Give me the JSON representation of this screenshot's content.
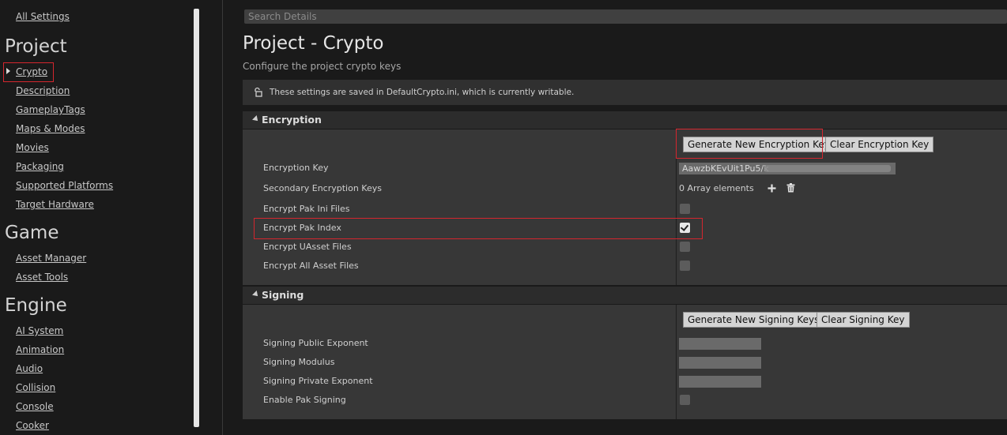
{
  "sidebar": {
    "all_settings": "All Settings",
    "sections": [
      {
        "title": "Project",
        "items": [
          "Crypto",
          "Description",
          "GameplayTags",
          "Maps & Modes",
          "Movies",
          "Packaging",
          "Supported Platforms",
          "Target Hardware"
        ]
      },
      {
        "title": "Game",
        "items": [
          "Asset Manager",
          "Asset Tools"
        ]
      },
      {
        "title": "Engine",
        "items": [
          "AI System",
          "Animation",
          "Audio",
          "Collision",
          "Console",
          "Cooker"
        ]
      }
    ],
    "selected": "Crypto"
  },
  "search": {
    "placeholder": "Search Details"
  },
  "page": {
    "title": "Project - Crypto",
    "subtitle": "Configure the project crypto keys",
    "info": "These settings are saved in DefaultCrypto.ini, which is currently writable."
  },
  "encryption": {
    "title": "Encryption",
    "generate_button": "Generate New Encryption Key",
    "clear_button": "Clear Encryption Key",
    "key_label": "Encryption Key",
    "key_value": "AawzbKEvUit1Pu5/k",
    "secondary_label": "Secondary Encryption Keys",
    "secondary_value": "0 Array elements",
    "pak_ini_label": "Encrypt Pak Ini Files",
    "pak_ini_checked": false,
    "pak_index_label": "Encrypt Pak Index",
    "pak_index_checked": true,
    "uasset_label": "Encrypt UAsset Files",
    "uasset_checked": false,
    "all_asset_label": "Encrypt All Asset Files",
    "all_asset_checked": false
  },
  "signing": {
    "title": "Signing",
    "generate_button": "Generate New Signing Keys",
    "clear_button": "Clear Signing Key",
    "public_exponent_label": "Signing Public Exponent",
    "modulus_label": "Signing Modulus",
    "private_exponent_label": "Signing Private Exponent",
    "enable_label": "Enable Pak Signing",
    "enable_checked": false
  },
  "colors": {
    "highlight": "#d4262e",
    "panel": "#373737",
    "background": "#1a1a1a"
  }
}
